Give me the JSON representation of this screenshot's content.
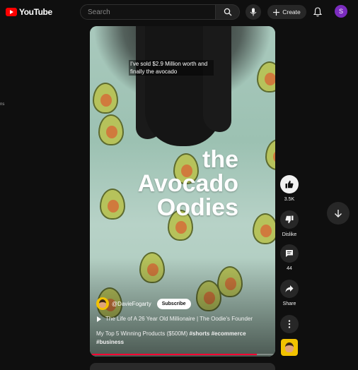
{
  "header": {
    "logo_text": "YouTube",
    "search_placeholder": "Search",
    "create_label": "Create",
    "avatar_initial": "S"
  },
  "sidebar_fragment": "ns",
  "video": {
    "caption": "I've sold $2.9 Million worth and finally the avocado",
    "overlay_title": [
      "the",
      "Avocado",
      "Oodies"
    ],
    "channel_handle": "@DavieFogarty",
    "subscribe_label": "Subscribe",
    "playlist_title": "The Life of A 26 Year Old Millionaire | The Oodie's Founder",
    "description_plain": "My Top 5 Winning Products ($500M) ",
    "hashtags_line1": "#shorts #ecommerce",
    "hashtags_line2": "#business",
    "progress_fraction": 0.9
  },
  "actions": {
    "like_count": "3.5K",
    "dislike_label": "Dislike",
    "comment_count": "44",
    "share_label": "Share"
  },
  "colors": {
    "brand_red": "#ff0000",
    "progress_red": "#ff0033",
    "avatar_purple": "#7b2cbf"
  },
  "icons": [
    "youtube-logo-icon",
    "search-icon",
    "mic-icon",
    "plus-icon",
    "bell-icon",
    "like-icon",
    "dislike-icon",
    "comment-icon",
    "share-icon",
    "more-icon",
    "arrow-down-icon",
    "play-icon"
  ]
}
